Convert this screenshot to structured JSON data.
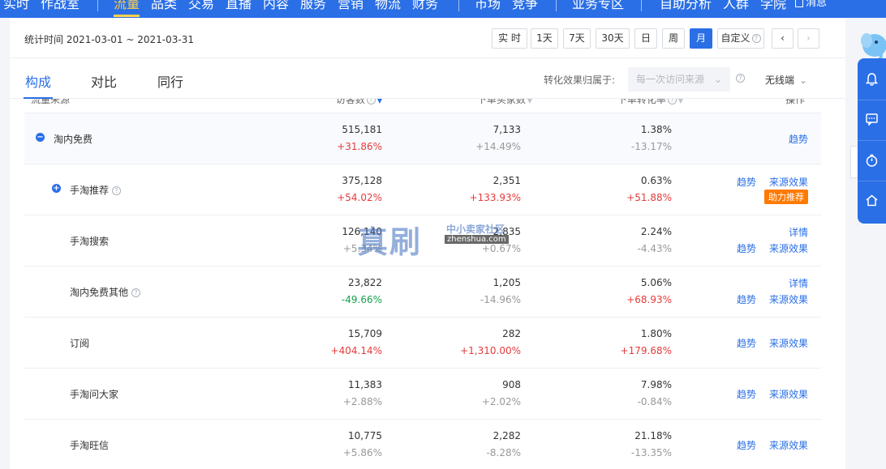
{
  "topnav": {
    "items": [
      "实时",
      "作战室",
      "流量",
      "品类",
      "交易",
      "直播",
      "内容",
      "服务",
      "营销",
      "物流",
      "财务",
      "市场",
      "竞争",
      "业务专区",
      "自助分析",
      "人群",
      "学院"
    ],
    "active_index": 2,
    "message_label": "消息"
  },
  "datebar": {
    "range_label": "统计时间 2021-03-01 ~ 2021-03-31",
    "buttons": [
      "实 时",
      "1天",
      "7天",
      "30天",
      "日",
      "周",
      "月",
      "自定义"
    ],
    "active_button_index": 6,
    "prev_icon": "‹",
    "next_icon": "›"
  },
  "tabs": {
    "items": [
      "构成",
      "对比",
      "同行"
    ],
    "active_index": 0
  },
  "attribution": {
    "label": "转化效果归属于:",
    "value": "每一次访问来源",
    "device": "无线端"
  },
  "table": {
    "headers": [
      "流量来源",
      "访客数",
      "下单买家数",
      "下单转化率",
      "操作"
    ],
    "rows": [
      {
        "name": "淘内免费",
        "expander": "minus",
        "visitors": "515,181",
        "visitors_change": "+31.86%",
        "visitors_trend": "up",
        "buyers": "7,133",
        "buyers_change": "+14.49%",
        "buyers_trend": "down",
        "rate": "1.38%",
        "rate_change": "-13.17%",
        "rate_trend": "down",
        "ops": [
          "趋势"
        ],
        "badge": ""
      },
      {
        "name": "手淘推荐",
        "expander": "plus",
        "help": true,
        "visitors": "375,128",
        "visitors_change": "+54.02%",
        "visitors_trend": "up",
        "buyers": "2,351",
        "buyers_change": "+133.93%",
        "buyers_trend": "up",
        "rate": "0.63%",
        "rate_change": "+51.88%",
        "rate_trend": "up",
        "ops": [
          "趋势",
          "来源效果"
        ],
        "badge": "助力推荐"
      },
      {
        "name": "手淘搜索",
        "visitors": "126,140",
        "visitors_change": "+5.34%",
        "visitors_trend": "down",
        "buyers": "2,835",
        "buyers_change": "+0.67%",
        "buyers_trend": "down",
        "rate": "2.24%",
        "rate_change": "-4.43%",
        "rate_trend": "down",
        "ops_top": "详情",
        "ops": [
          "趋势",
          "来源效果"
        ],
        "badge": ""
      },
      {
        "name": "淘内免费其他",
        "help": true,
        "visitors": "23,822",
        "visitors_change": "-49.66%",
        "visitors_trend": "green",
        "buyers": "1,205",
        "buyers_change": "-14.96%",
        "buyers_trend": "down",
        "rate": "5.06%",
        "rate_change": "+68.93%",
        "rate_trend": "up",
        "ops_top": "详情",
        "ops": [
          "趋势",
          "来源效果"
        ],
        "badge": ""
      },
      {
        "name": "订阅",
        "visitors": "15,709",
        "visitors_change": "+404.14%",
        "visitors_trend": "up",
        "buyers": "282",
        "buyers_change": "+1,310.00%",
        "buyers_trend": "up",
        "rate": "1.80%",
        "rate_change": "+179.68%",
        "rate_trend": "up",
        "ops": [
          "趋势",
          "来源效果"
        ],
        "badge": ""
      },
      {
        "name": "手淘问大家",
        "visitors": "11,383",
        "visitors_change": "+2.88%",
        "visitors_trend": "down",
        "buyers": "908",
        "buyers_change": "+2.02%",
        "buyers_trend": "down",
        "rate": "7.98%",
        "rate_change": "-0.84%",
        "rate_trend": "down",
        "ops": [
          "趋势",
          "来源效果"
        ],
        "badge": ""
      },
      {
        "name": "手淘旺信",
        "visitors": "10,775",
        "visitors_change": "+5.86%",
        "visitors_trend": "down",
        "buyers": "2,282",
        "buyers_change": "-8.28%",
        "buyers_trend": "down",
        "rate": "21.18%",
        "rate_change": "-13.35%",
        "rate_trend": "down",
        "ops": [
          "趋势",
          "来源效果"
        ],
        "badge": ""
      }
    ]
  },
  "watermark": {
    "big": "真刷",
    "small": "中小卖家社区",
    "url": "zhenshua.com"
  },
  "sidebar": {
    "icons": [
      "bell-icon",
      "chat-icon",
      "timer-icon",
      "home-icon"
    ]
  },
  "colors": {
    "brand_blue": "#2a6fe6",
    "up_red": "#e63b3b",
    "down_green": "#15a04a",
    "badge_orange": "#ff7a00"
  }
}
